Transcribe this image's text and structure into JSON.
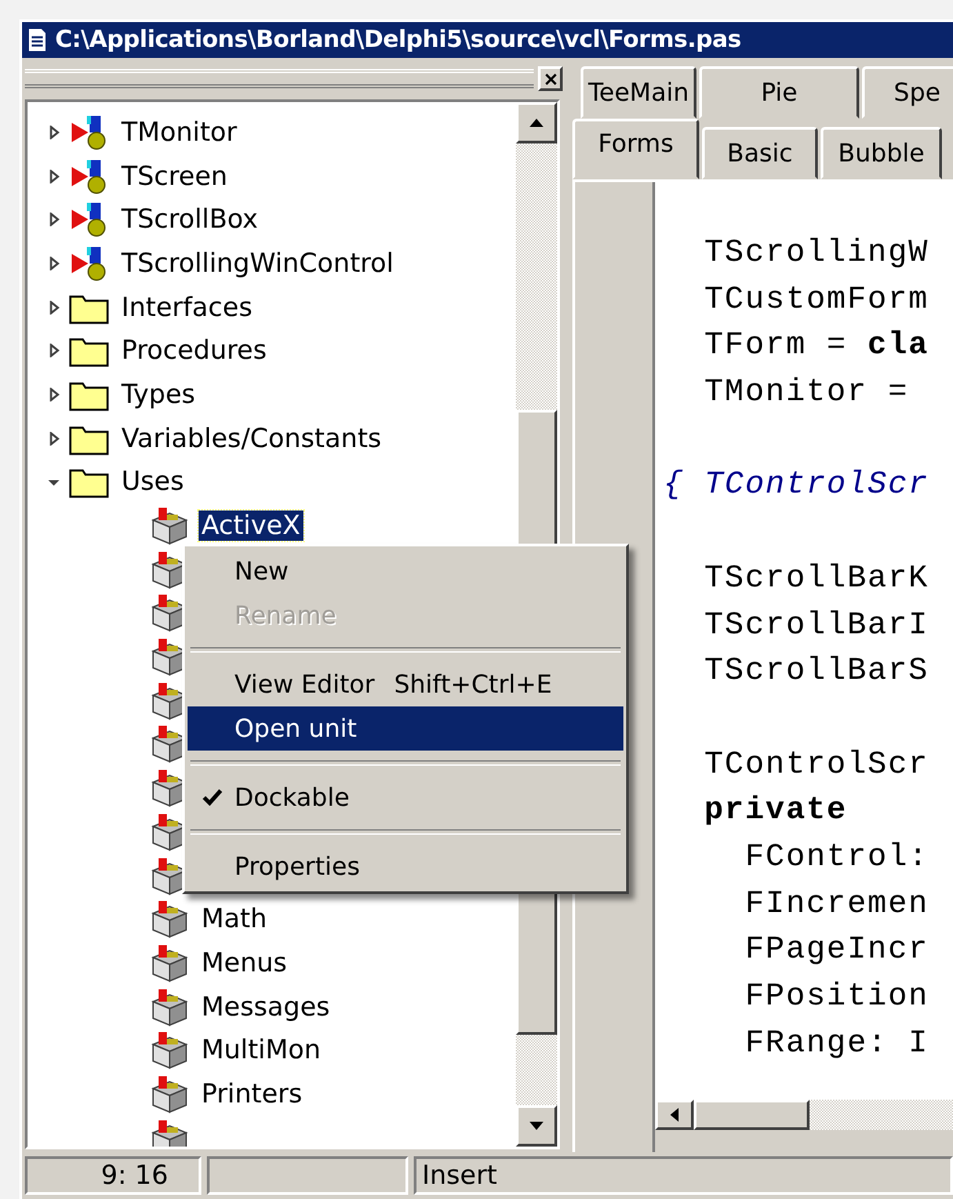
{
  "title": "C:\\Applications\\Borland\\Delphi5\\source\\vcl\\Forms.pas",
  "explorer": {
    "items": [
      {
        "label": "TMonitor",
        "kind": "class",
        "expanded": false
      },
      {
        "label": "TScreen",
        "kind": "class",
        "expanded": false
      },
      {
        "label": "TScrollBox",
        "kind": "class",
        "expanded": false
      },
      {
        "label": "TScrollingWinControl",
        "kind": "class",
        "expanded": false
      },
      {
        "label": "Interfaces",
        "kind": "folder",
        "expanded": false
      },
      {
        "label": "Procedures",
        "kind": "folder",
        "expanded": false
      },
      {
        "label": "Types",
        "kind": "folder",
        "expanded": false
      },
      {
        "label": "Variables/Constants",
        "kind": "folder",
        "expanded": false
      },
      {
        "label": "Uses",
        "kind": "folder",
        "expanded": true,
        "children": [
          {
            "label": "ActiveX",
            "kind": "unit",
            "selected": true
          },
          {
            "kind": "unit",
            "selected": false
          },
          {
            "kind": "unit",
            "selected": false
          },
          {
            "kind": "unit",
            "selected": false
          },
          {
            "kind": "unit",
            "selected": false
          },
          {
            "kind": "unit",
            "selected": false
          },
          {
            "kind": "unit",
            "selected": false
          },
          {
            "kind": "unit",
            "selected": false
          },
          {
            "kind": "unit",
            "selected": false
          },
          {
            "label": "Math",
            "kind": "unit",
            "selected": false
          },
          {
            "label": "Menus",
            "kind": "unit",
            "selected": false
          },
          {
            "label": "Messages",
            "kind": "unit",
            "selected": false
          },
          {
            "label": "MultiMon",
            "kind": "unit",
            "selected": false
          },
          {
            "label": "Printers",
            "kind": "unit",
            "selected": false
          },
          {
            "kind": "unit",
            "selected": false
          }
        ]
      }
    ]
  },
  "context_menu": {
    "items": [
      {
        "kind": "item",
        "label": "New",
        "disabled": false,
        "selected": false,
        "checked": false
      },
      {
        "kind": "item",
        "label": "Rename",
        "disabled": true,
        "selected": false,
        "checked": false
      },
      {
        "kind": "separator"
      },
      {
        "kind": "item",
        "label": "View Editor",
        "shortcut": "Shift+Ctrl+E",
        "disabled": false,
        "selected": false,
        "checked": false
      },
      {
        "kind": "item",
        "label": "Open unit",
        "disabled": false,
        "selected": true,
        "checked": false
      },
      {
        "kind": "separator"
      },
      {
        "kind": "item",
        "label": "Dockable",
        "disabled": false,
        "selected": false,
        "checked": true
      },
      {
        "kind": "separator"
      },
      {
        "kind": "item",
        "label": "Properties",
        "disabled": false,
        "selected": false,
        "checked": false
      }
    ]
  },
  "tabs": {
    "rows": [
      [
        {
          "label": "TeeMain",
          "selected": false
        },
        {
          "label": "Pie",
          "selected": false
        },
        {
          "label": "Spe",
          "selected": false
        }
      ],
      [
        {
          "label": "Forms",
          "selected": true
        },
        {
          "label": "Basic",
          "selected": false
        },
        {
          "label": "Bubble",
          "selected": false
        }
      ]
    ]
  },
  "code": {
    "lines": [
      {
        "kind": "code",
        "text": "  TScrollingW"
      },
      {
        "kind": "code",
        "text": "  TCustomForm"
      },
      {
        "kind": "code",
        "text": "  TForm = **cla**"
      },
      {
        "kind": "code",
        "text": "  TMonitor ="
      },
      {
        "kind": "blank"
      },
      {
        "kind": "comment",
        "text": "{ TControlScr"
      },
      {
        "kind": "blank"
      },
      {
        "kind": "code",
        "text": "  TScrollBarK"
      },
      {
        "kind": "code",
        "text": "  TScrollBarI"
      },
      {
        "kind": "code",
        "text": "  TScrollBarS"
      },
      {
        "kind": "blank"
      },
      {
        "kind": "code",
        "text": "  TControlScr"
      },
      {
        "kind": "code",
        "text": "  **private**"
      },
      {
        "kind": "code",
        "text": "    FControl:"
      },
      {
        "kind": "code",
        "text": "    FIncremen"
      },
      {
        "kind": "code",
        "text": "    FPageIncr"
      },
      {
        "kind": "code",
        "text": "    FPosition"
      },
      {
        "kind": "code",
        "text": "    FRange: I"
      }
    ]
  },
  "status_bar": {
    "position": "9: 16",
    "mode": "Insert"
  }
}
